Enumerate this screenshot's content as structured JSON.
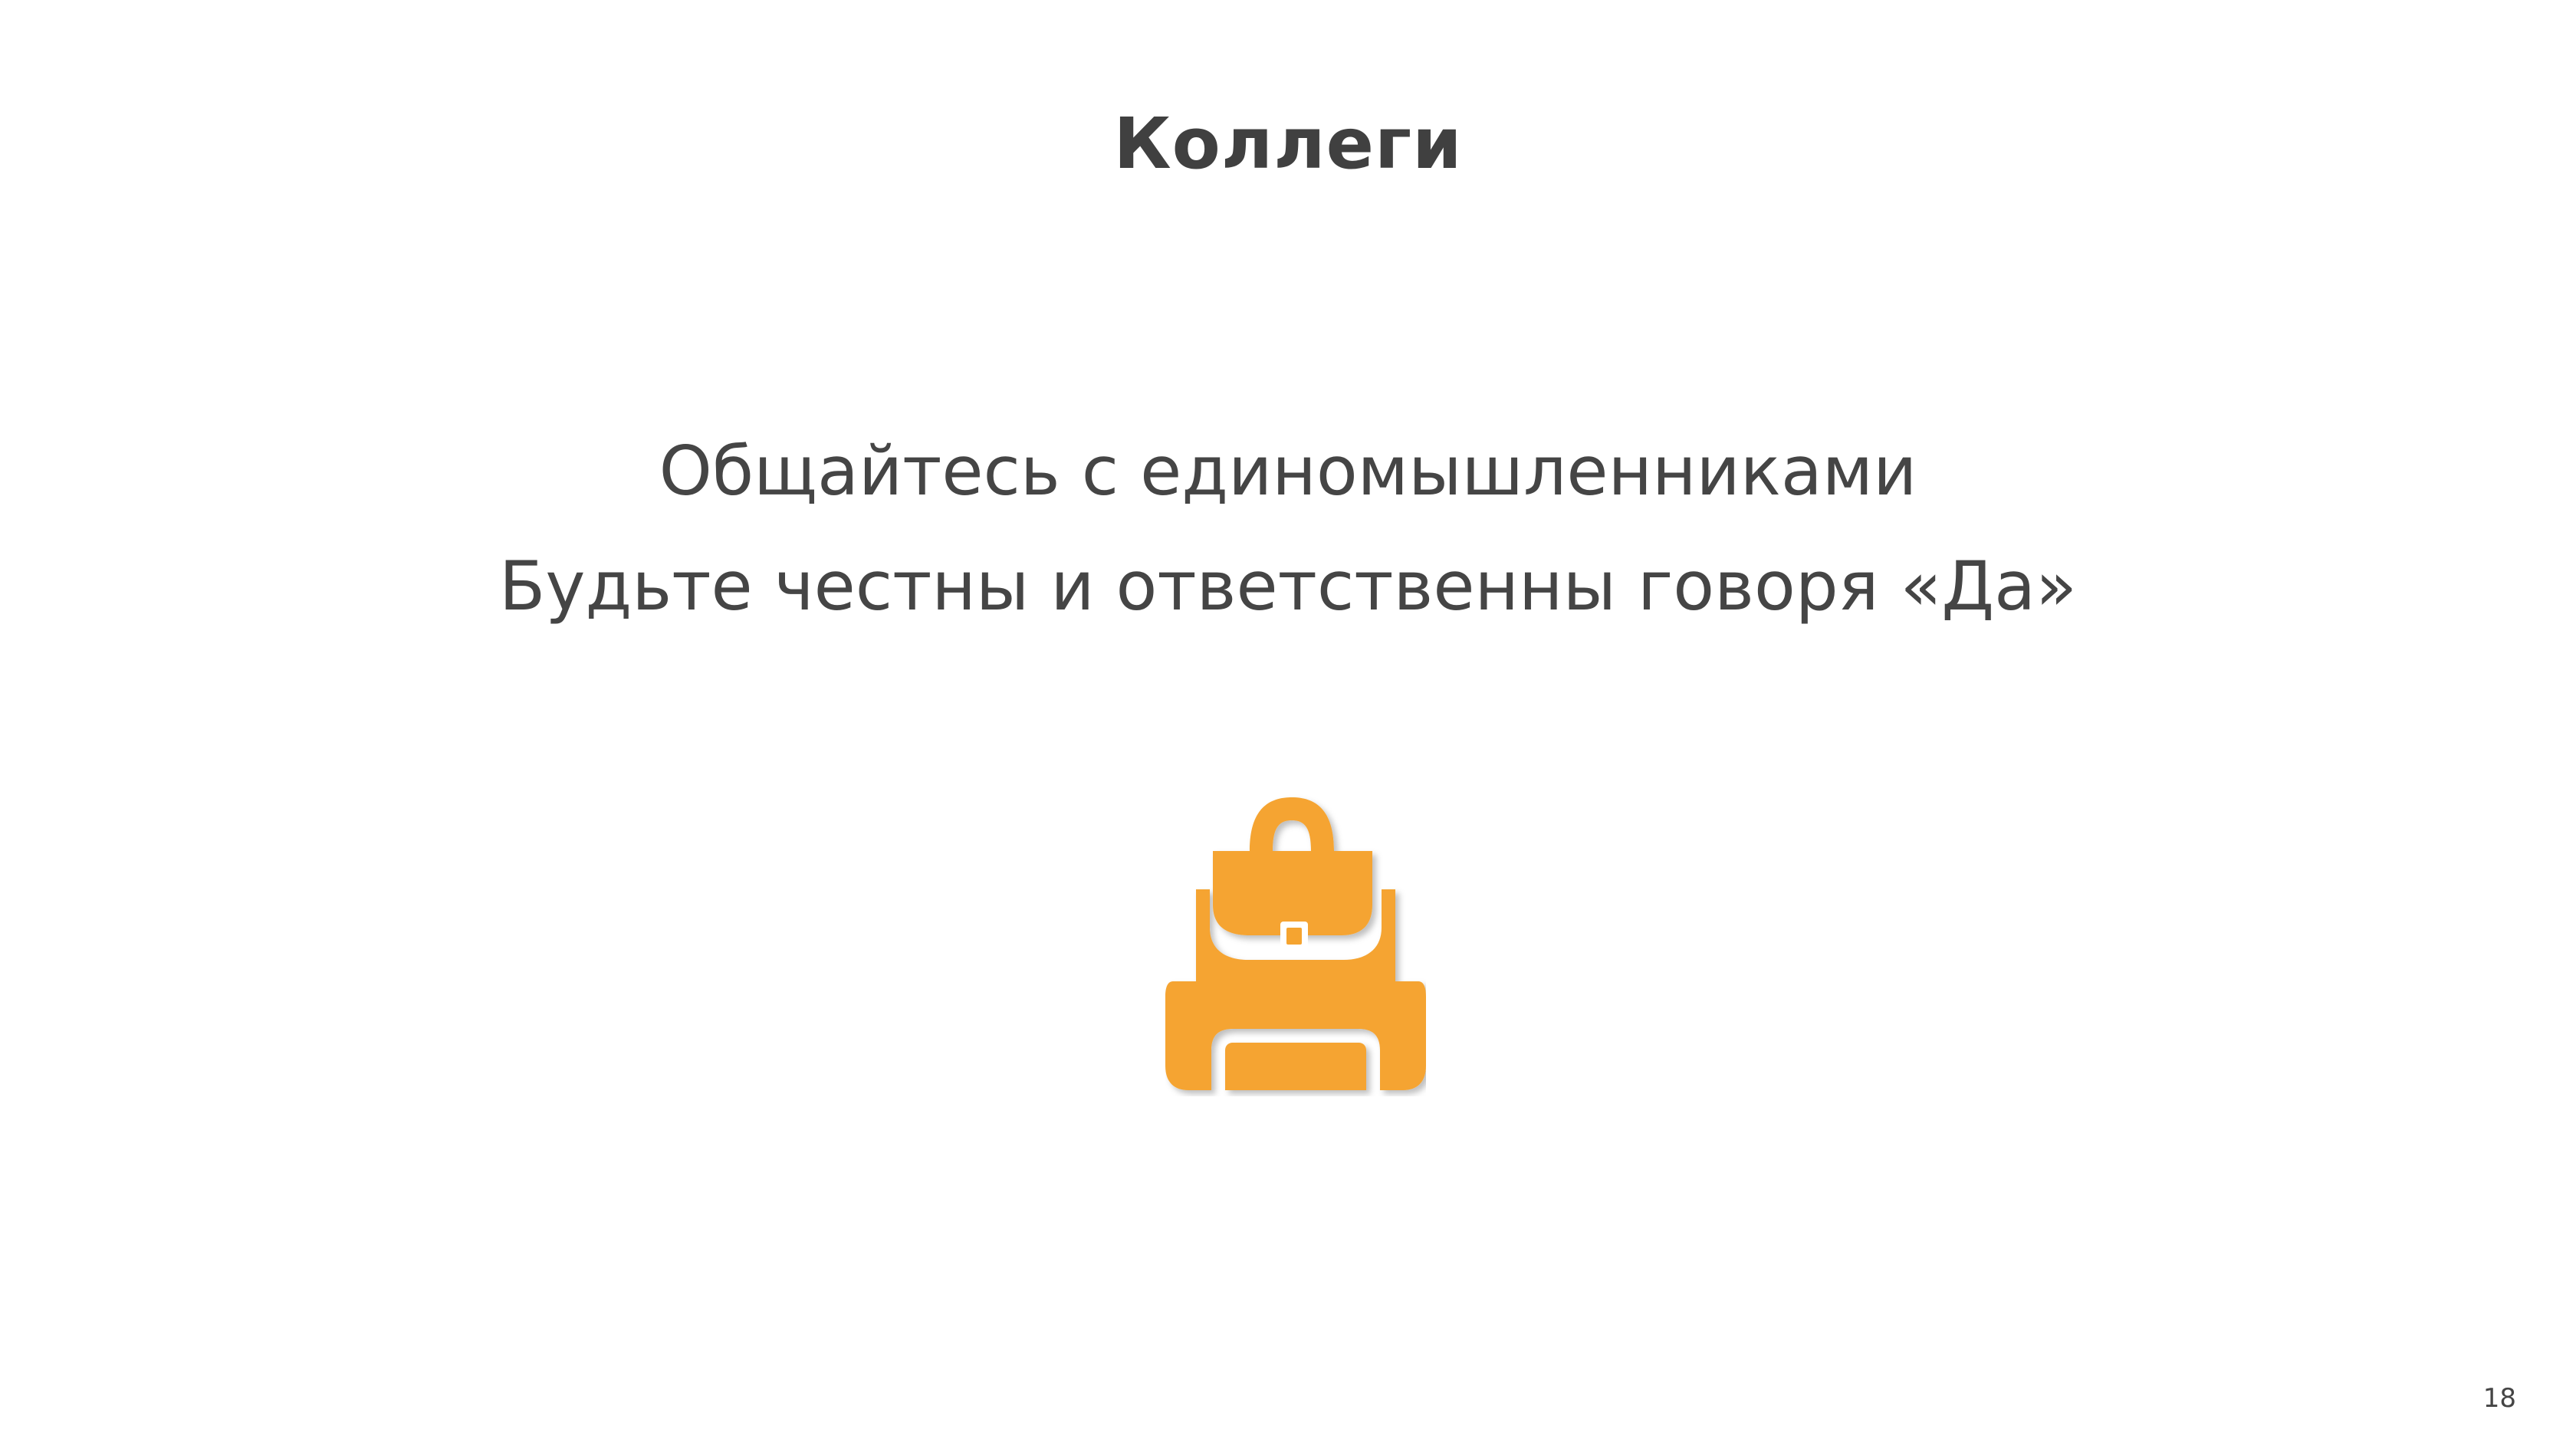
{
  "slide": {
    "title": "Коллеги",
    "lines": [
      "Общайтесь с единомышленниками",
      "Будьте честны и ответственны говоря «Да»"
    ],
    "icon": "backpack-icon",
    "page_number": "18"
  },
  "colors": {
    "title": "#404040",
    "text": "#454545",
    "icon": "#F5A430",
    "background": "#FFFFFF"
  }
}
